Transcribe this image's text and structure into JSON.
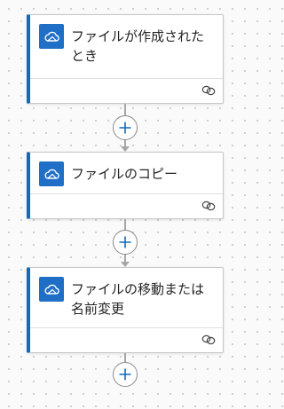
{
  "flow": {
    "steps": [
      {
        "title": "ファイルが作成されたとき",
        "icon": "onedrive-cloud-icon",
        "footer_icon": "connection-link-icon"
      },
      {
        "title": "ファイルのコピー",
        "icon": "onedrive-cloud-icon",
        "footer_icon": "connection-link-icon"
      },
      {
        "title": "ファイルの移動または名前変更",
        "icon": "onedrive-cloud-icon",
        "footer_icon": "connection-link-icon"
      }
    ],
    "add_button_icon": "plus-icon"
  },
  "colors": {
    "accent": "#0f6cbd",
    "app_icon_bg": "#1f6fc7",
    "connector": "#a6a6a6",
    "canvas": "#fafafa"
  }
}
